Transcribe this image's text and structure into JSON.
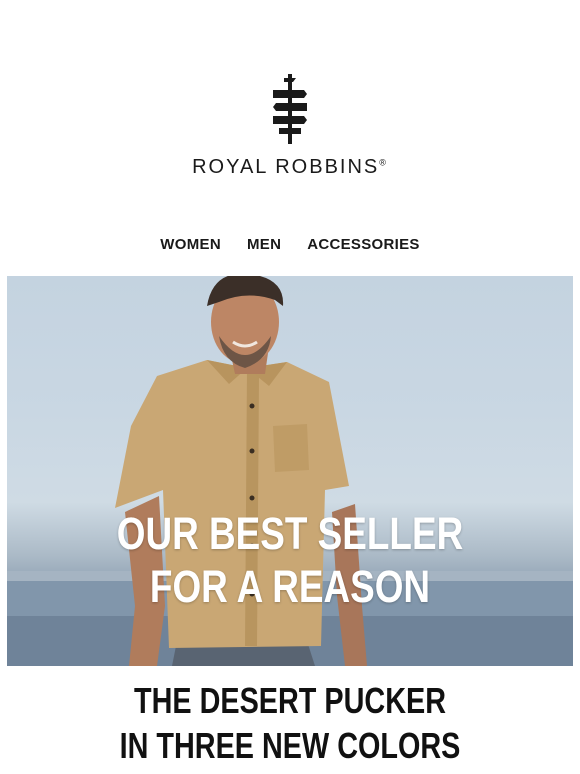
{
  "brand": {
    "name": "ROYAL ROBBINS",
    "mark": "®"
  },
  "nav": [
    {
      "label": "WOMEN"
    },
    {
      "label": "MEN"
    },
    {
      "label": "ACCESSORIES"
    }
  ],
  "hero": {
    "headline_line1": "OUR BEST SELLER",
    "headline_line2": "FOR A REASON"
  },
  "promo": {
    "line1": "THE DESERT PUCKER",
    "line2": "IN THREE NEW COLORS"
  },
  "colors": {
    "text": "#1a1a1a",
    "sky": "#c9d7e3",
    "sea": "#7689a0",
    "shirt": "#c9a774"
  },
  "icons": [
    "tree-signpost-logo-icon"
  ]
}
